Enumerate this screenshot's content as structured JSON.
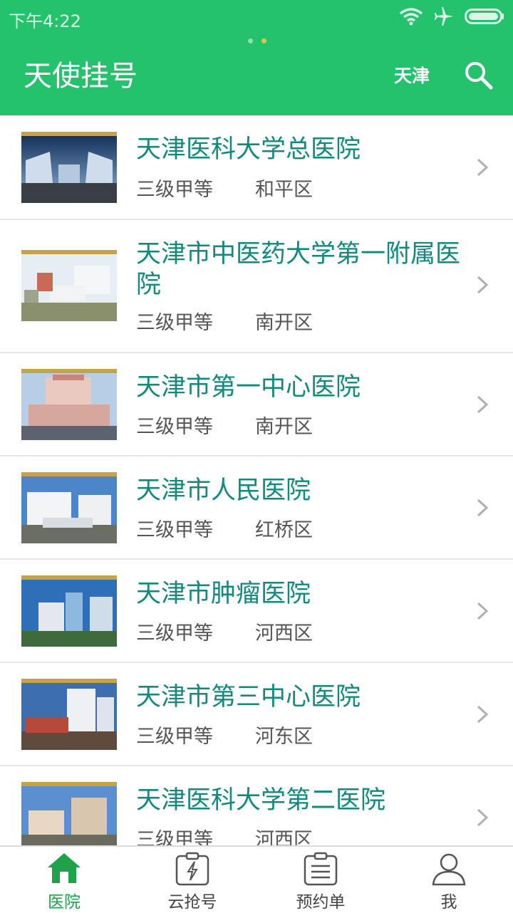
{
  "status": {
    "time": "下午4:22"
  },
  "header": {
    "title": "天使挂号",
    "city": "天津"
  },
  "hospitals": [
    {
      "name": "天津医科大学总医院",
      "level": "三级甲等",
      "district": "和平区"
    },
    {
      "name": "天津市中医药大学第一附属医院",
      "level": "三级甲等",
      "district": "南开区"
    },
    {
      "name": "天津市第一中心医院",
      "level": "三级甲等",
      "district": "南开区"
    },
    {
      "name": "天津市人民医院",
      "level": "三级甲等",
      "district": "红桥区"
    },
    {
      "name": "天津市肿瘤医院",
      "level": "三级甲等",
      "district": "河西区"
    },
    {
      "name": "天津市第三中心医院",
      "level": "三级甲等",
      "district": "河东区"
    },
    {
      "name": "天津医科大学第二医院",
      "level": "三级甲等",
      "district": "河西区"
    }
  ],
  "nav": {
    "hospital": "医院",
    "cloud": "云抢号",
    "orders": "预约单",
    "me": "我"
  },
  "colors": {
    "primary": "#24c26c",
    "hospital_name": "#118a7d",
    "nav_active": "#1fa24a"
  }
}
